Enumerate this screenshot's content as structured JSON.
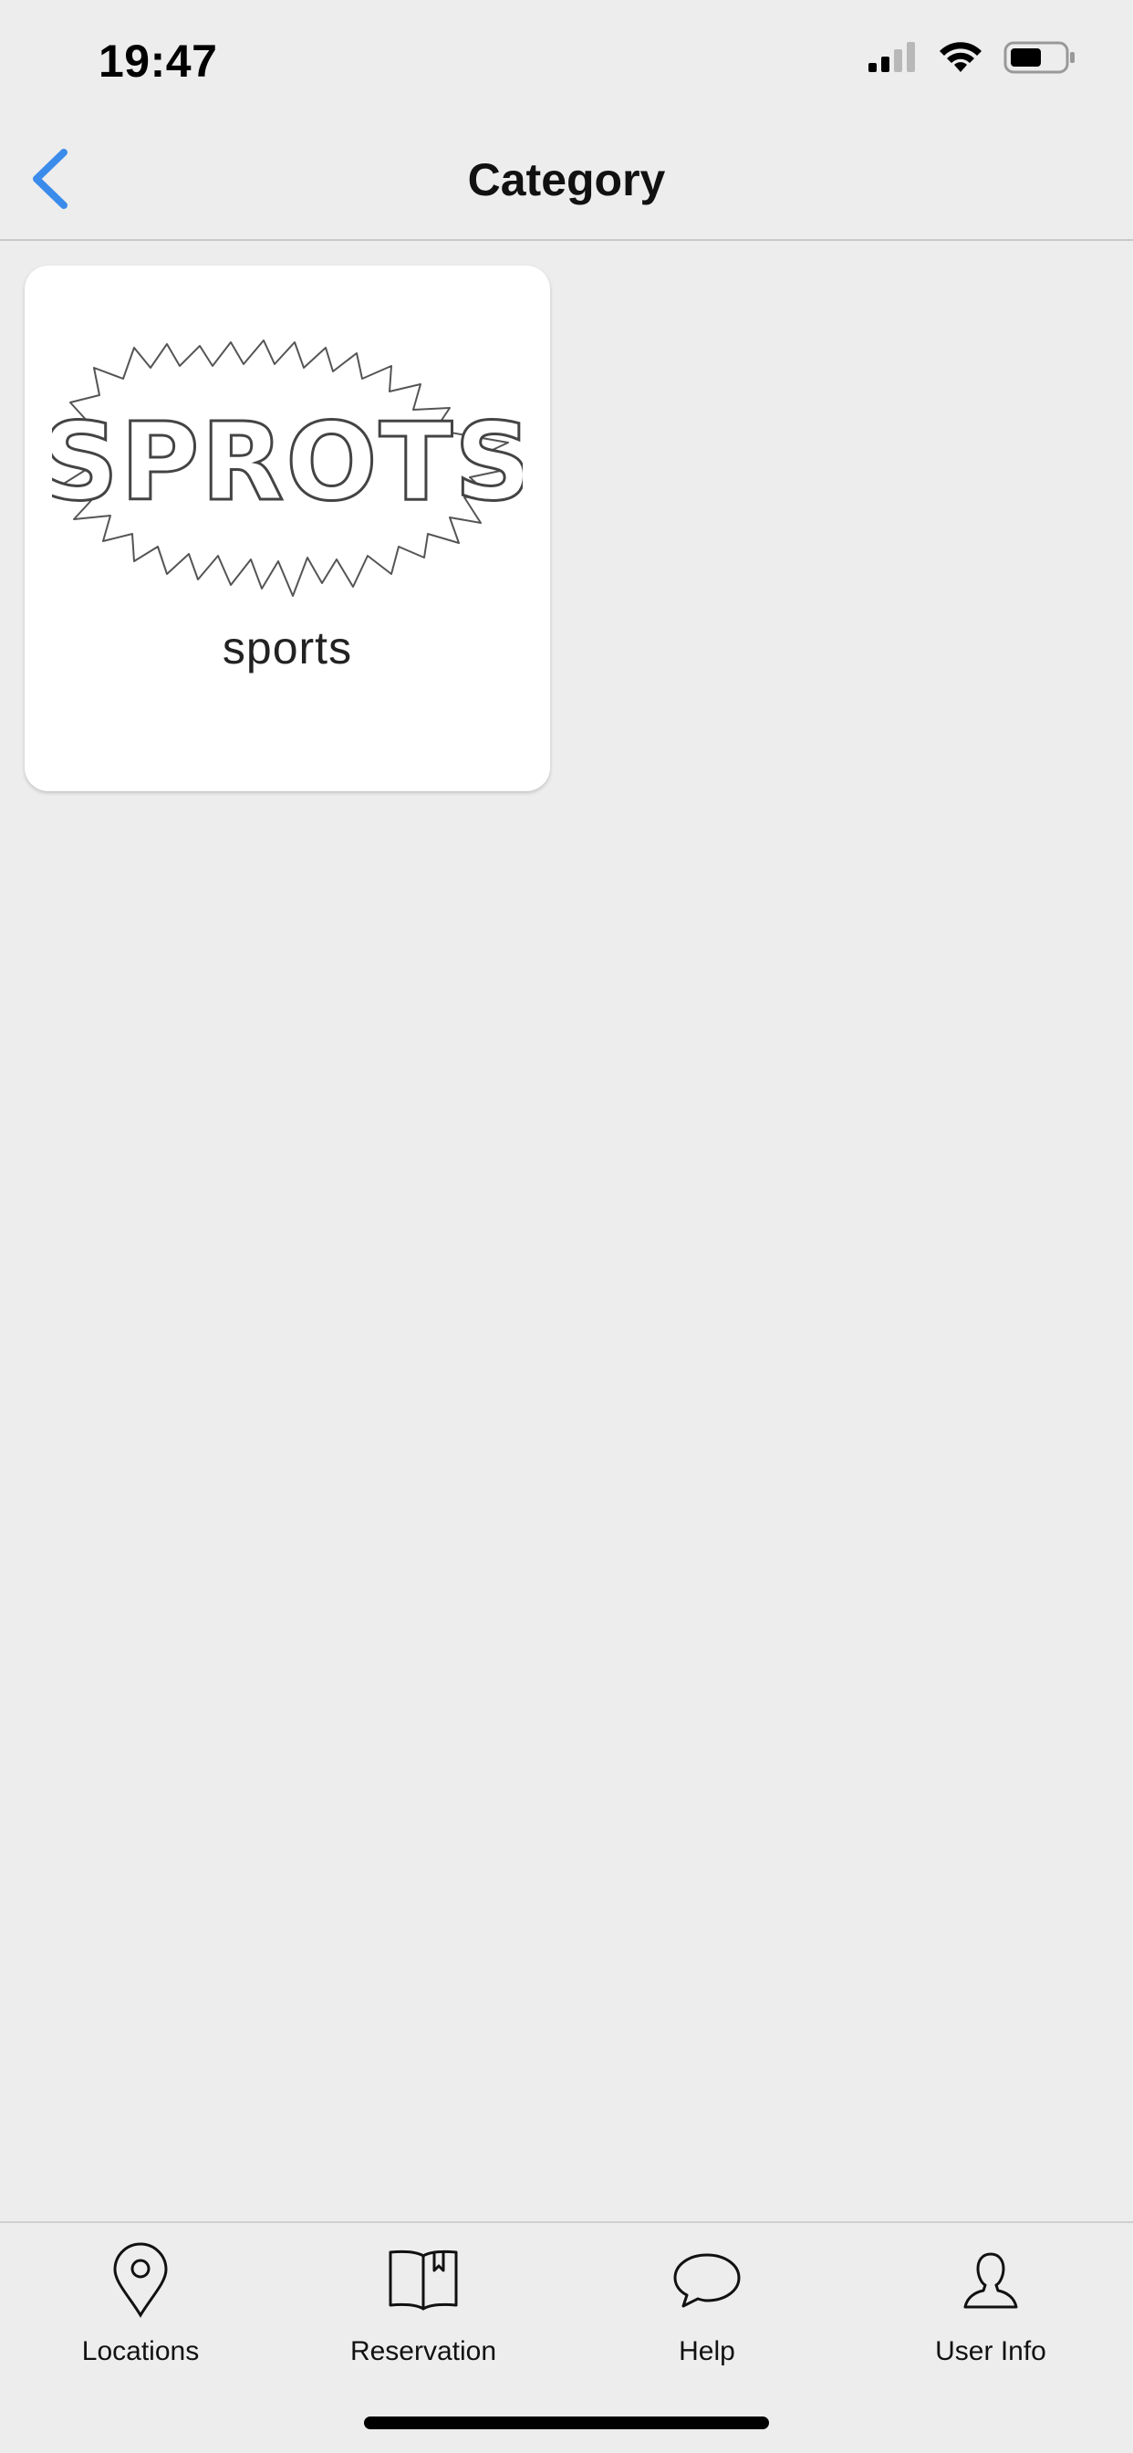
{
  "status_bar": {
    "time": "19:47",
    "icons": [
      "cellular-signal-icon",
      "wifi-icon",
      "battery-icon"
    ]
  },
  "nav": {
    "title": "Category",
    "back_icon": "chevron-left-icon",
    "accent_color": "#3b8beb"
  },
  "categories": [
    {
      "label": "sports",
      "image_text": "SPROTS",
      "image_icon": "sprots-burst-illustration"
    }
  ],
  "tab_bar": {
    "items": [
      {
        "label": "Locations",
        "icon": "location-pin-icon"
      },
      {
        "label": "Reservation",
        "icon": "book-icon"
      },
      {
        "label": "Help",
        "icon": "speech-bubble-icon"
      },
      {
        "label": "User Info",
        "icon": "user-icon"
      }
    ]
  }
}
